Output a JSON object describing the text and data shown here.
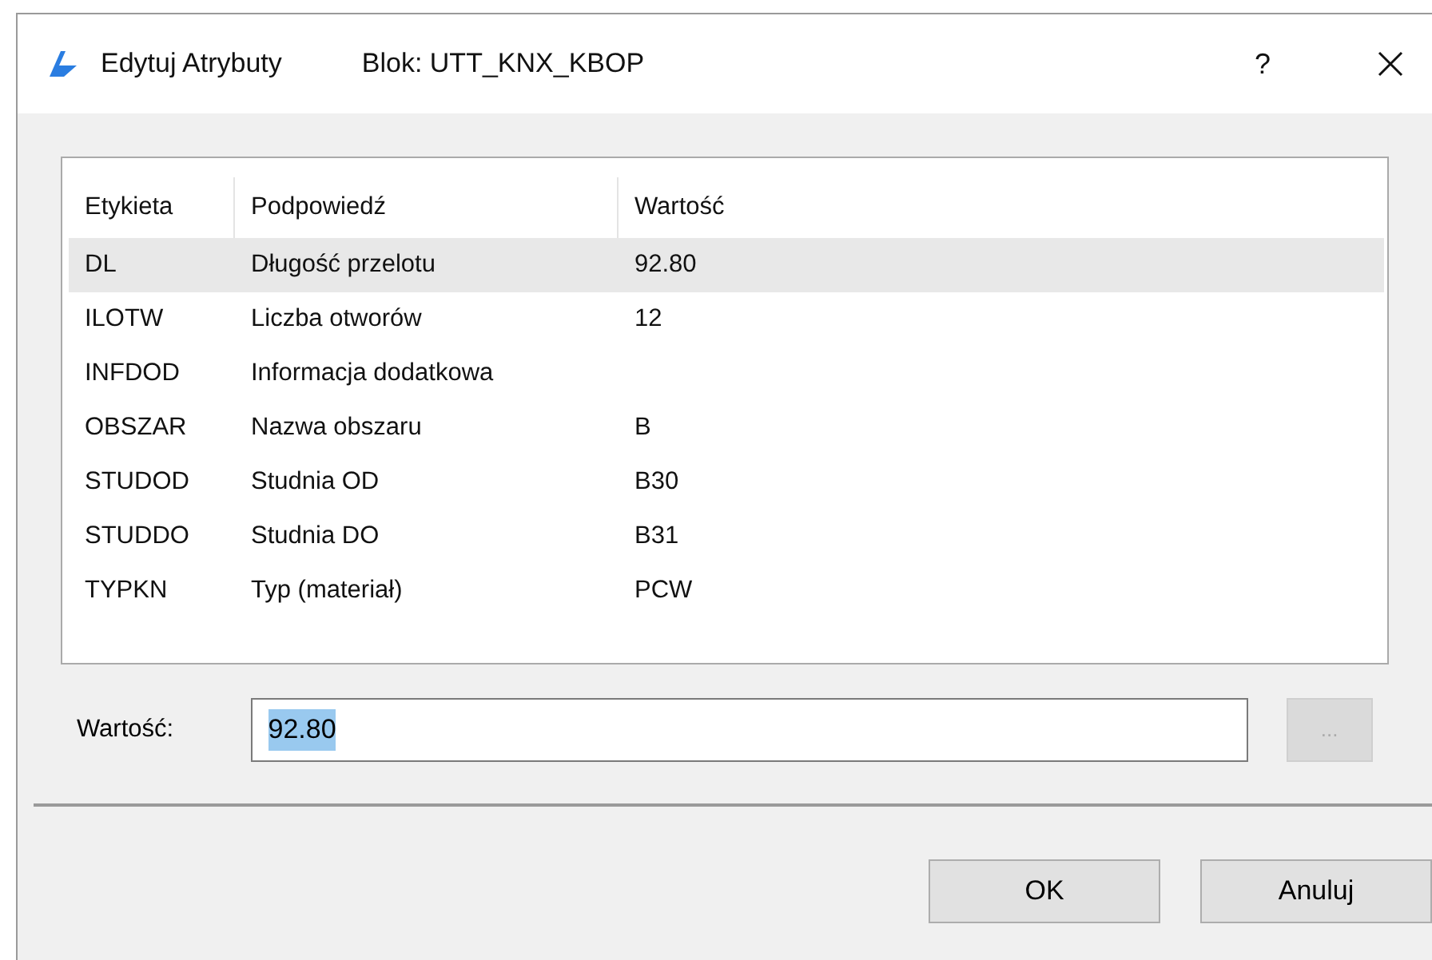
{
  "window": {
    "title": "Edytuj Atrybuty",
    "subtitle": "Blok: UTT_KNX_KBOP",
    "help": "?"
  },
  "table": {
    "columns": [
      "Etykieta",
      "Podpowiedź",
      "Wartość"
    ],
    "rows": [
      {
        "cells": [
          "DL",
          "Długość przelotu",
          "92.80"
        ],
        "selected": true
      },
      {
        "cells": [
          "ILOTW",
          "Liczba otworów",
          "12"
        ],
        "selected": false
      },
      {
        "cells": [
          "INFDOD",
          "Informacja dodatkowa",
          ""
        ],
        "selected": false
      },
      {
        "cells": [
          "OBSZAR",
          "Nazwa obszaru",
          "B"
        ],
        "selected": false
      },
      {
        "cells": [
          "STUDOD",
          "Studnia OD",
          "B30"
        ],
        "selected": false
      },
      {
        "cells": [
          "STUDDO",
          "Studnia DO",
          "B31"
        ],
        "selected": false
      },
      {
        "cells": [
          "TYPKN",
          "Typ (materiał)",
          "PCW"
        ],
        "selected": false
      }
    ]
  },
  "value_field": {
    "label": "Wartość:",
    "value": "92.80",
    "text_selected": true,
    "browse_button": {
      "label": "...",
      "disabled": true
    }
  },
  "buttons": [
    "OK",
    "Anuluj"
  ]
}
